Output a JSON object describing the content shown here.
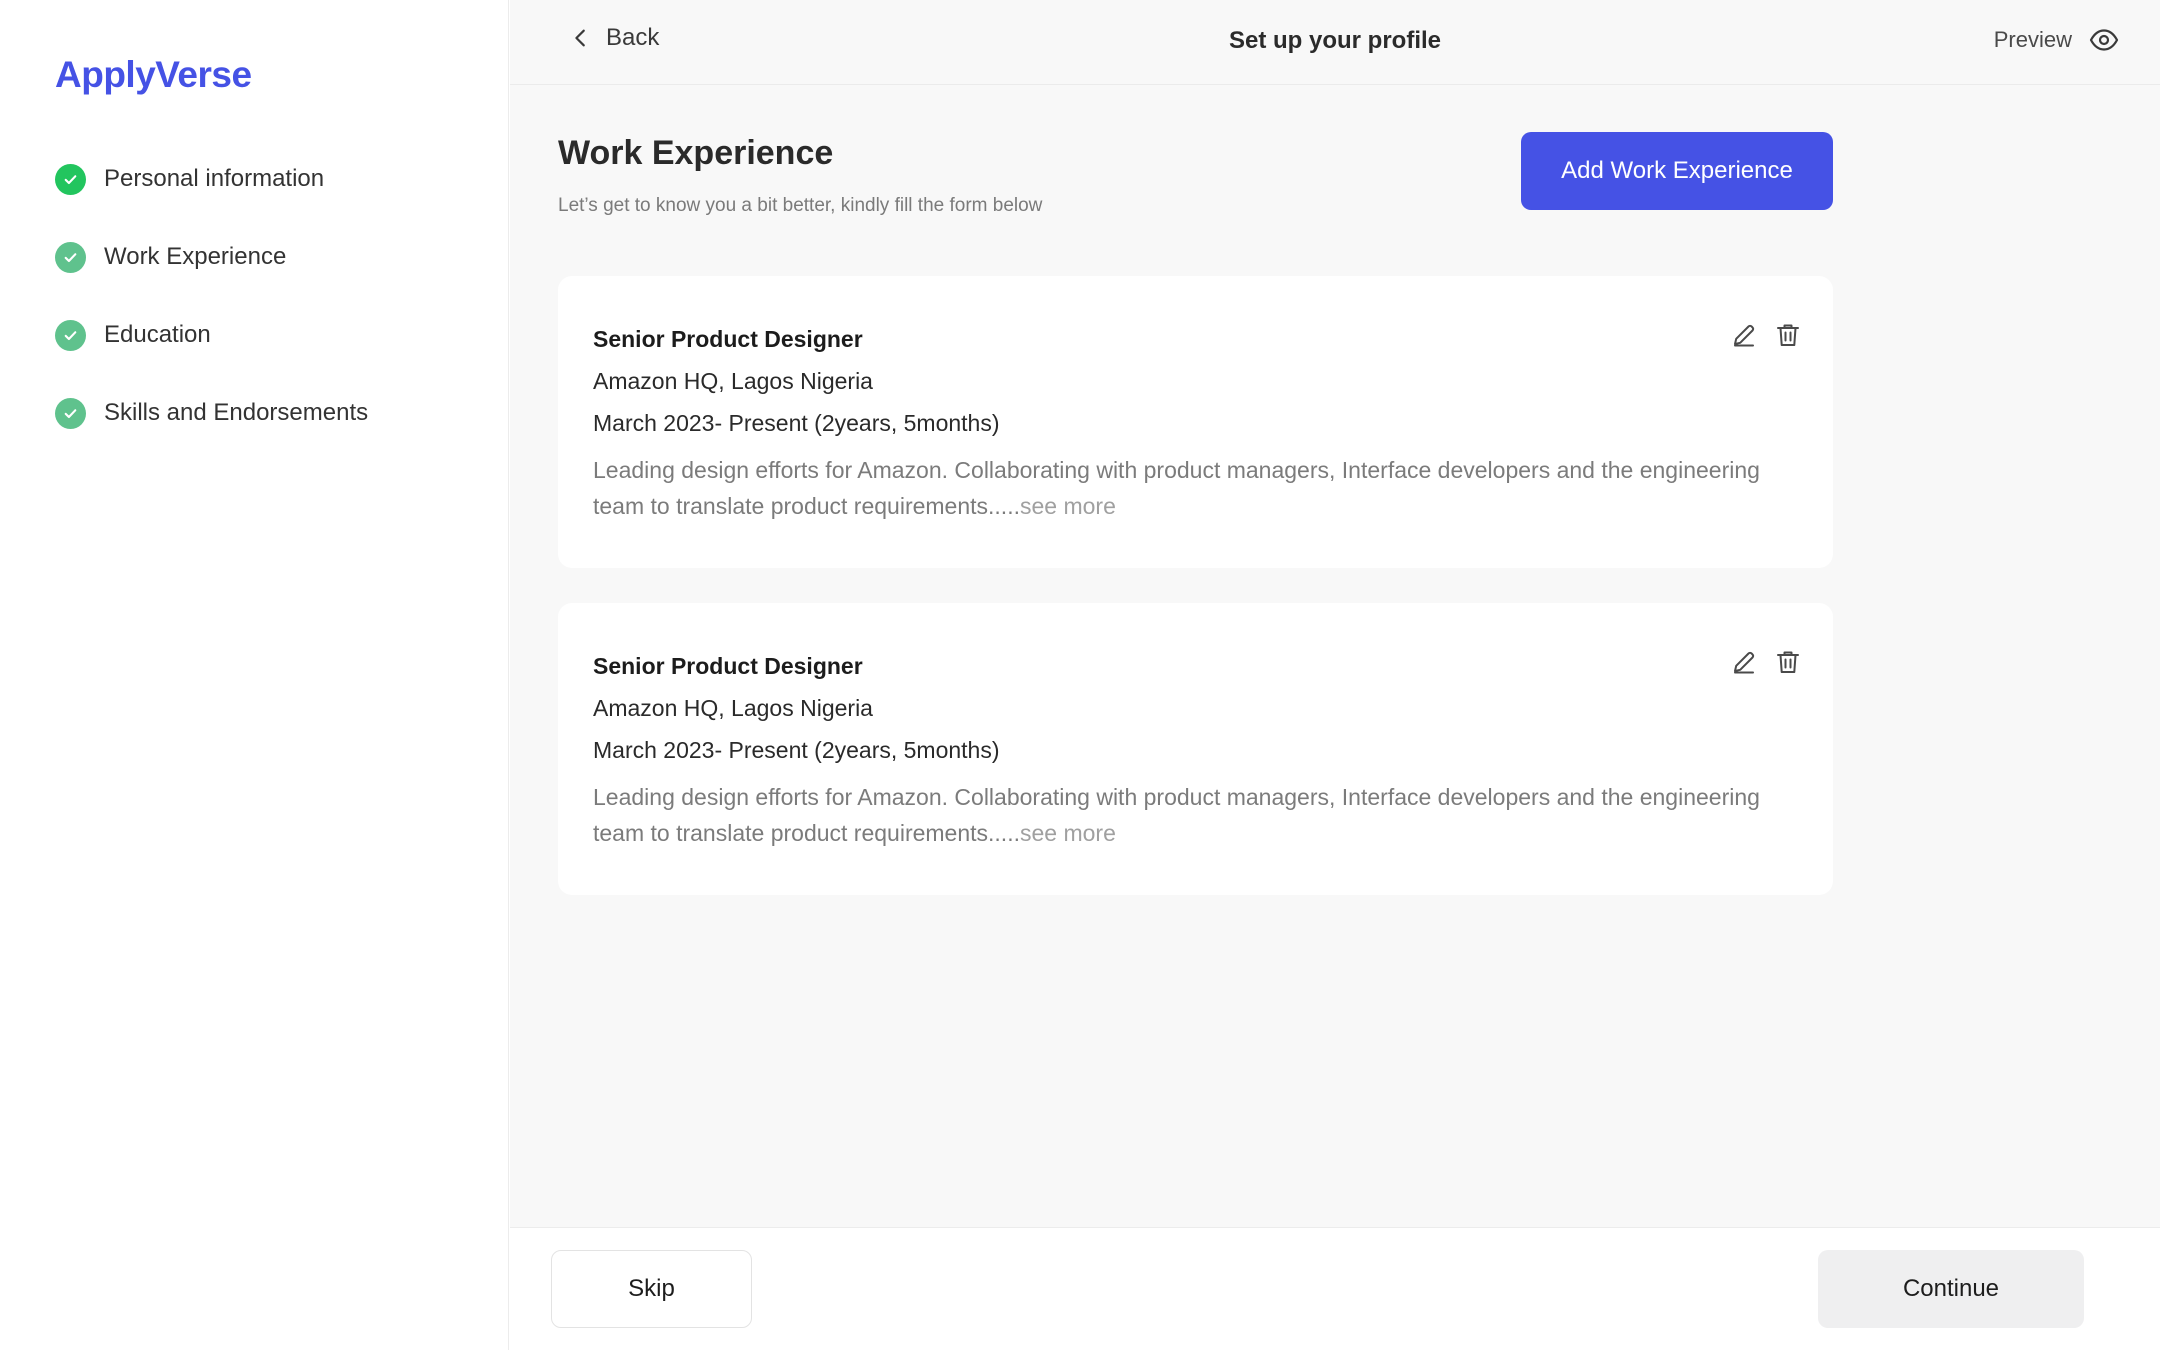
{
  "app": {
    "logo": "ApplyVerse"
  },
  "colors": {
    "accent": "#4552e5",
    "success": "#22c55e",
    "success_muted": "#5fc28d"
  },
  "sidebar": {
    "steps": [
      {
        "label": "Personal information",
        "icon": "check-circle-icon",
        "status": "complete"
      },
      {
        "label": "Work Experience",
        "icon": "check-circle-icon",
        "status": "complete"
      },
      {
        "label": "Education",
        "icon": "check-circle-icon",
        "status": "complete"
      },
      {
        "label": "Skills and Endorsements",
        "icon": "check-circle-icon",
        "status": "complete"
      }
    ]
  },
  "topbar": {
    "back_label": "Back",
    "title": "Set up your profile",
    "preview_label": "Preview"
  },
  "section": {
    "title": "Work Experience",
    "subtitle": "Let’s get to know you a bit better, kindly fill the form below",
    "add_button": "Add Work Experience"
  },
  "experiences": [
    {
      "title": "Senior Product Designer",
      "company": "Amazon HQ, Lagos Nigeria",
      "dates": "March 2023- Present (2years, 5months)",
      "description": "Leading design efforts for Amazon. Collaborating with product managers, Interface developers and the engineering team to translate product requirements.....",
      "see_more": "see more"
    },
    {
      "title": "Senior Product Designer",
      "company": "Amazon HQ, Lagos Nigeria",
      "dates": "March 2023- Present (2years, 5months)",
      "description": "Leading design efforts for Amazon. Collaborating with product managers, Interface developers and the engineering team to translate product requirements.....",
      "see_more": "see more"
    }
  ],
  "footer": {
    "skip_label": "Skip",
    "continue_label": "Continue"
  }
}
